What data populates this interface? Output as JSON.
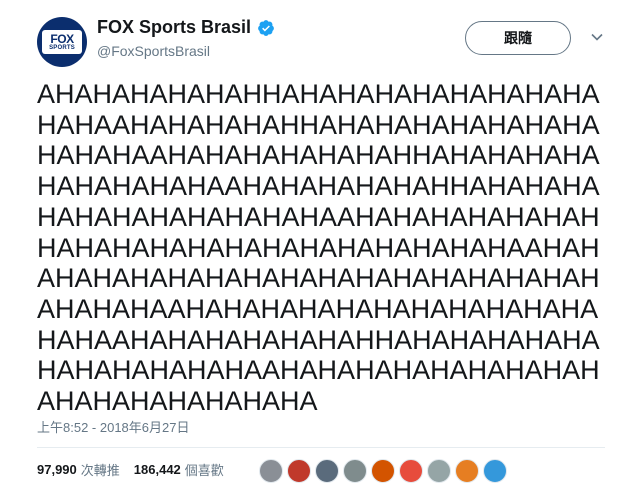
{
  "account": {
    "display_name": "FOX Sports Brasil",
    "handle": "@FoxSportsBrasil",
    "verified": true,
    "avatar_line1": "FOX",
    "avatar_line2": "SPORTS"
  },
  "follow_button_label": "跟隨",
  "tweet_text": "AHAHAHAHAHAHHAHAHAHAHAHAHAHAHAHAHAAHAHAHAHAHHAHAHAHAHAHAHAHAHAHAHAAHAHAHAHAHAHAHHAHAHAHAHAHAHAHAHAHAAHAHAHAHAHAHHAHAHAHAHAHAHAHAHAHAHAHAAHAHAHAHAHAHAHHAHAHAHAHAHAHAHAHAHAHAHAHAAHAHAHAHAHAHAHAHAHAHAHAHAHAHAHAHAHAHAHAHAAHAHAHAHAHAHAHAHAHAHAHAHAHAAHAHAHAHAHAHAHHAHAHAHAHAHAHAHAHAHAHAHAAHAHAHAHAHAHAHAHAHAHAHAHAHAHAHAHA",
  "timestamp": "上午8:52 - 2018年6月27日",
  "stats": {
    "retweets_count": "97,990",
    "retweets_label": "次轉推",
    "likes_count": "186,442",
    "likes_label": "個喜歡"
  },
  "likers": [
    {
      "name": "liker-avatar-1",
      "color": "#8a8f96"
    },
    {
      "name": "liker-avatar-2",
      "color": "#c0392b"
    },
    {
      "name": "liker-avatar-3",
      "color": "#5a6b7c"
    },
    {
      "name": "liker-avatar-4",
      "color": "#7f8c8d"
    },
    {
      "name": "liker-avatar-5",
      "color": "#d35400"
    },
    {
      "name": "liker-avatar-6",
      "color": "#e74c3c"
    },
    {
      "name": "liker-avatar-7",
      "color": "#95a5a6"
    },
    {
      "name": "liker-avatar-8",
      "color": "#e67e22"
    },
    {
      "name": "liker-avatar-9",
      "color": "#3498db"
    }
  ],
  "colors": {
    "verified_badge": "#1da1f2",
    "avatar_bg": "#0b2e6e",
    "secondary_text": "#657786"
  }
}
